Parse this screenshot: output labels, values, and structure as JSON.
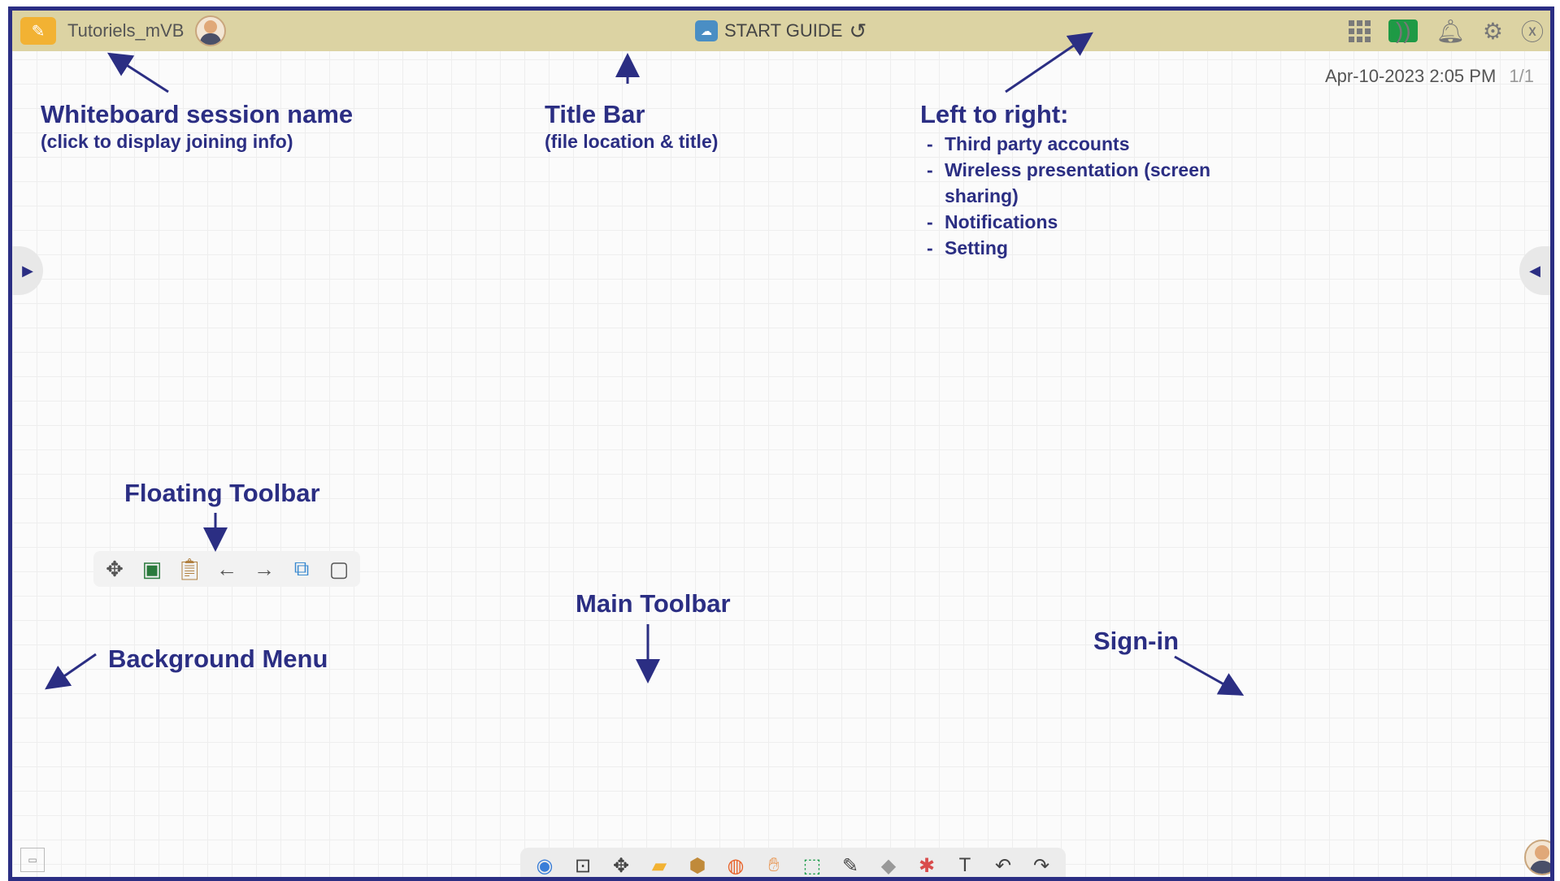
{
  "titlebar": {
    "session_name": "Tutoriels_mVB",
    "title": "START GUIDE",
    "right_icons": [
      "apps-grid-icon",
      "wireless-cast-icon",
      "bell-icon",
      "gear-icon",
      "close-icon"
    ]
  },
  "date": {
    "datetime": "Apr-10-2023 2:05 PM",
    "page": "1/1"
  },
  "annotations": {
    "session": {
      "heading": "Whiteboard session name",
      "sub": "(click to display joining info)"
    },
    "titlebar": {
      "heading": "Title Bar",
      "sub": "(file location & title)"
    },
    "right": {
      "heading": "Left to right:",
      "items": [
        "Third party accounts",
        "Wireless presentation (screen sharing)",
        "Notifications",
        "Setting"
      ]
    },
    "floating": {
      "heading": "Floating Toolbar"
    },
    "main": {
      "heading": "Main Toolbar"
    },
    "background": {
      "heading": "Background Menu"
    },
    "signin": {
      "heading": "Sign-in"
    }
  },
  "floating_toolbar": [
    "move-icon",
    "image-icon",
    "clipboard-icon",
    "arrow-left-icon",
    "arrow-right-icon",
    "add-page-icon",
    "page-icon"
  ],
  "main_toolbar": [
    "users-icon",
    "screenshot-icon",
    "move-icon",
    "folder-icon",
    "box-icon",
    "browser-icon",
    "hand-icon",
    "select-icon",
    "marker-icon",
    "eraser-icon",
    "shapes-icon",
    "text-icon",
    "undo-icon",
    "redo-icon"
  ]
}
